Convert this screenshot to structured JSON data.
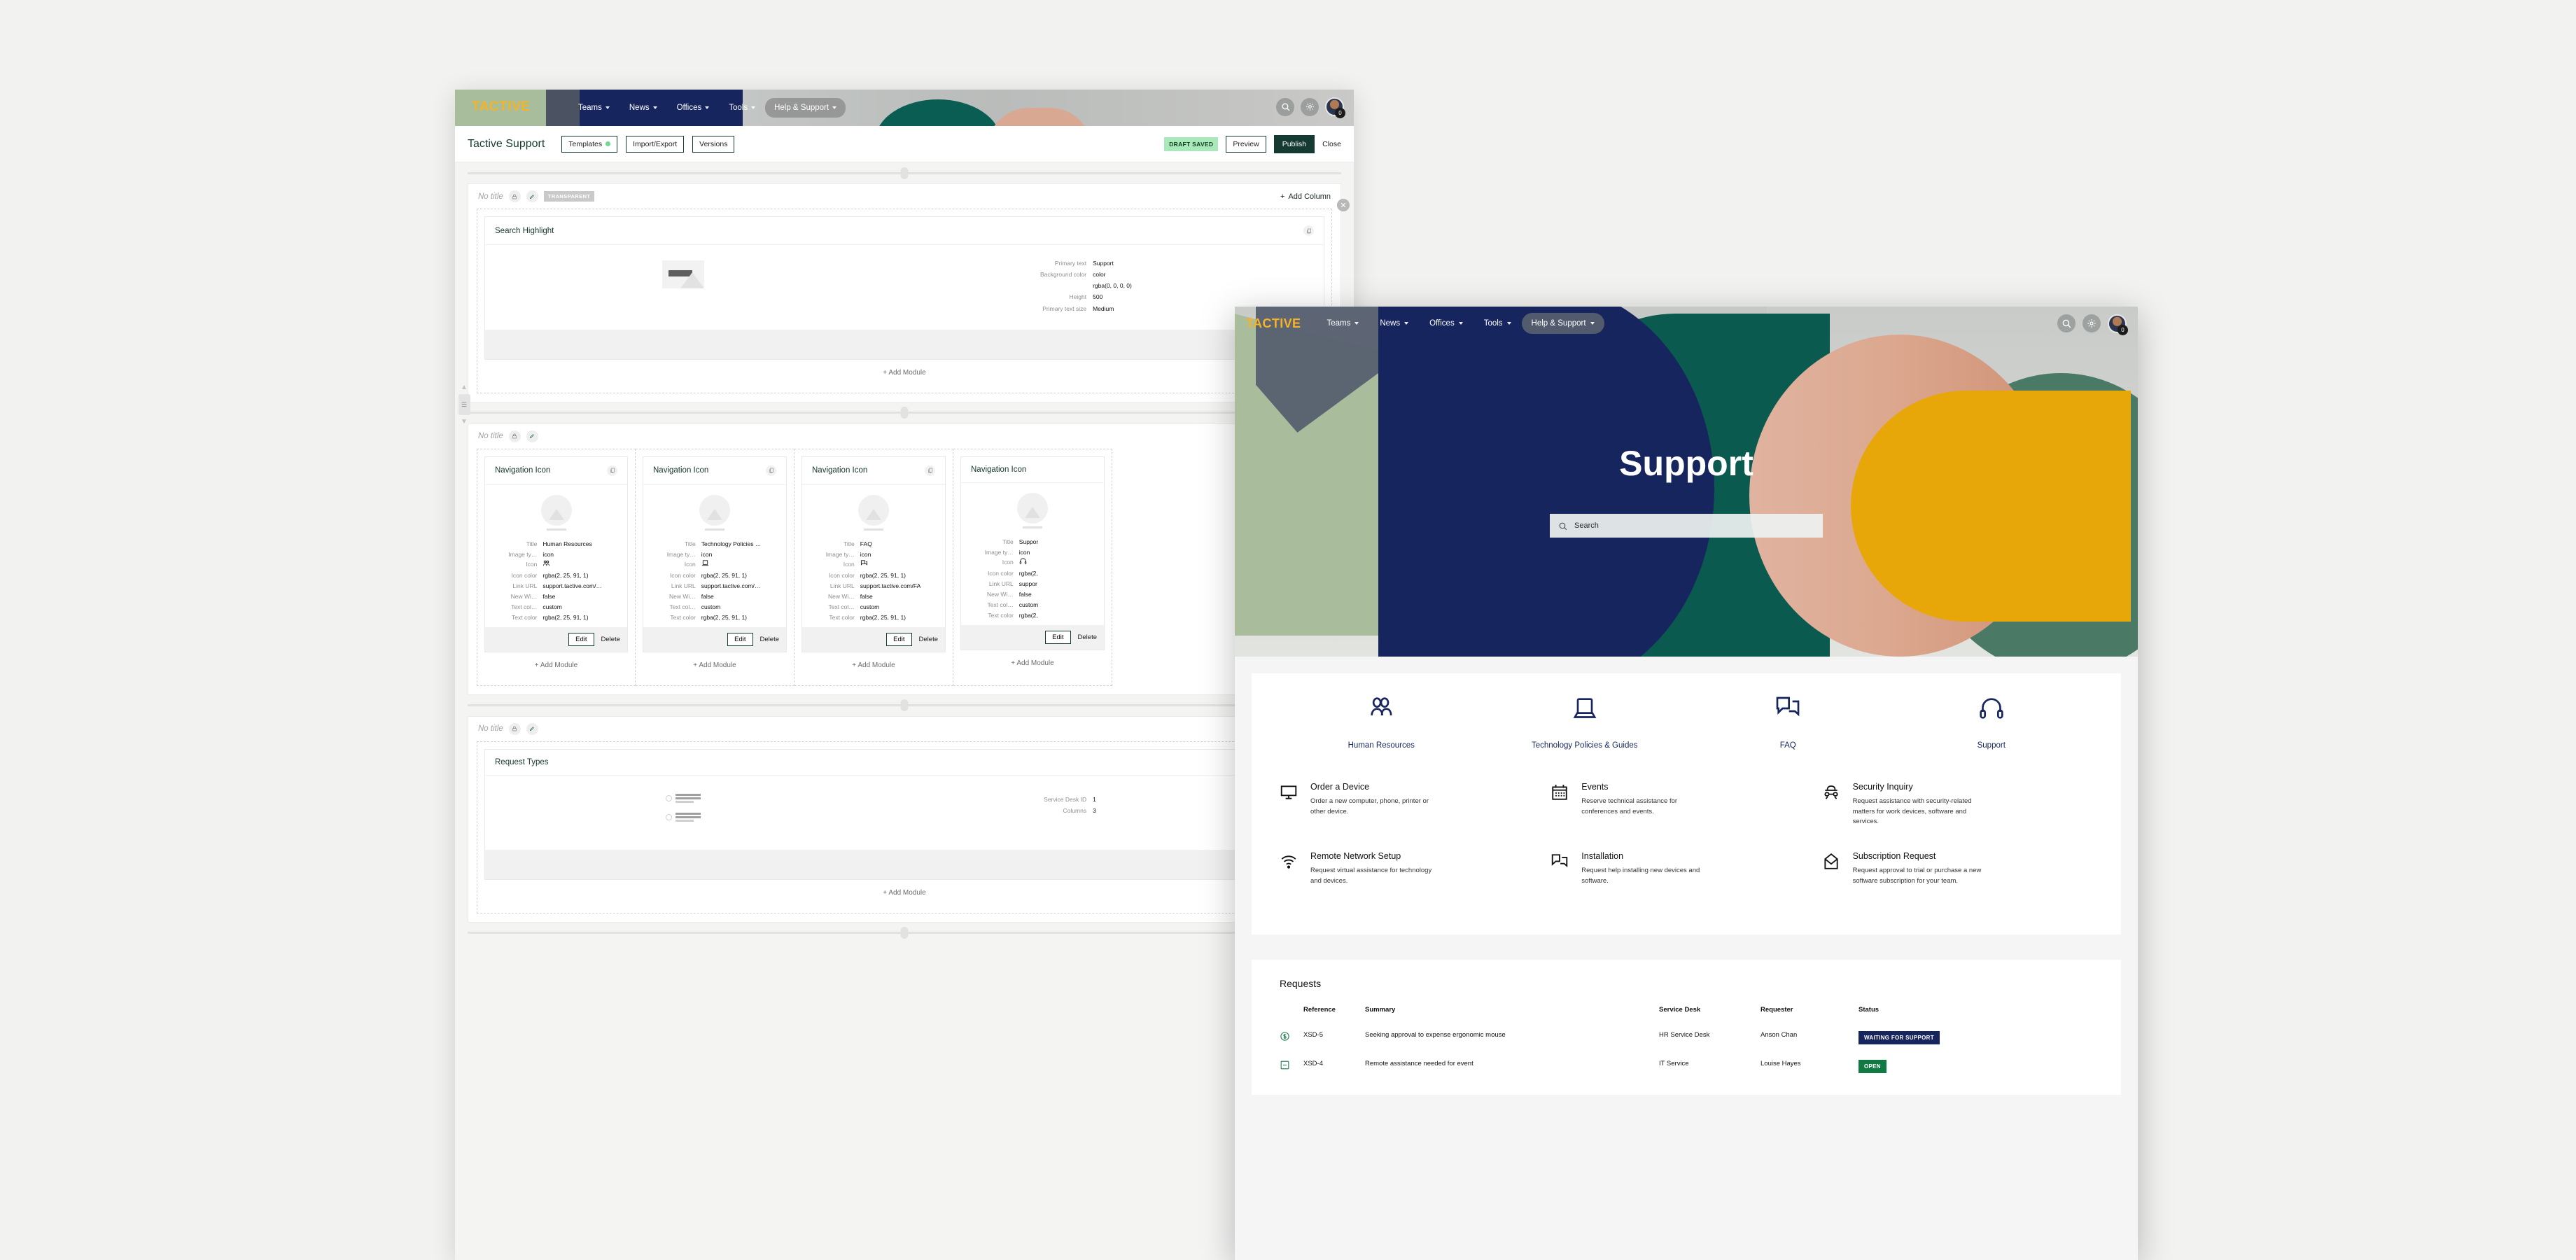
{
  "editor": {
    "brand": "TACTIVE",
    "nav": [
      {
        "label": "Teams",
        "caret": true,
        "pill": false
      },
      {
        "label": "News",
        "caret": true,
        "pill": false
      },
      {
        "label": "Offices",
        "caret": true,
        "pill": false
      },
      {
        "label": "Tools",
        "caret": true,
        "pill": false
      },
      {
        "label": "Help & Support",
        "caret": true,
        "pill": true
      }
    ],
    "avatar_badge": "0",
    "toolbar": {
      "title": "Tactive Support",
      "templates_label": "Templates",
      "import_export_label": "Import/Export",
      "versions_label": "Versions",
      "draft_status": "DRAFT SAVED",
      "preview_label": "Preview",
      "publish_label": "Publish",
      "close_label": "Close"
    },
    "sections": [
      {
        "title_placeholder": "No title",
        "tag": "TRANSPARENT",
        "add_column_label": "Add Column",
        "add_module_label": "Add Module"
      },
      {
        "title_placeholder": "No title",
        "add_module_label": "Add Module"
      },
      {
        "title_placeholder": "No title",
        "add_module_label": "Add Module"
      }
    ],
    "search_highlight_module": {
      "title": "Search Highlight",
      "fields": [
        {
          "key": "Primary text",
          "value": "Support"
        },
        {
          "key": "Background color",
          "value": "color"
        },
        {
          "key": "",
          "value": "rgba(0, 0, 0, 0)"
        },
        {
          "key": "Height",
          "value": "500"
        },
        {
          "key": "Primary text size",
          "value": "Medium"
        }
      ]
    },
    "nav_icon_modules": [
      {
        "title": "Navigation Icon",
        "icon_glyph": "people",
        "fields": [
          {
            "key": "Title",
            "value": "Human Resources"
          },
          {
            "key": "Image ty…",
            "value": "icon"
          },
          {
            "key": "Icon",
            "value": "",
            "glyph": "people"
          },
          {
            "key": "Icon color",
            "value": "rgba(2, 25, 91, 1)"
          },
          {
            "key": "Link URL",
            "value": "support.tactive.com/…"
          },
          {
            "key": "New Wi…",
            "value": "false"
          },
          {
            "key": "Text col…",
            "value": "custom"
          },
          {
            "key": "Text color",
            "value": "rgba(2, 25, 91, 1)"
          }
        ],
        "edit_label": "Edit",
        "delete_label": "Delete"
      },
      {
        "title": "Navigation Icon",
        "icon_glyph": "laptop",
        "fields": [
          {
            "key": "Title",
            "value": "Technology Policies …"
          },
          {
            "key": "Image ty…",
            "value": "icon"
          },
          {
            "key": "Icon",
            "value": "",
            "glyph": "laptop"
          },
          {
            "key": "Icon color",
            "value": "rgba(2, 25, 91, 1)"
          },
          {
            "key": "Link URL",
            "value": "support.tactive.com/…"
          },
          {
            "key": "New Wi…",
            "value": "false"
          },
          {
            "key": "Text col…",
            "value": "custom"
          },
          {
            "key": "Text color",
            "value": "rgba(2, 25, 91, 1)"
          }
        ],
        "edit_label": "Edit",
        "delete_label": "Delete"
      },
      {
        "title": "Navigation Icon",
        "icon_glyph": "chat",
        "fields": [
          {
            "key": "Title",
            "value": "FAQ"
          },
          {
            "key": "Image ty…",
            "value": "icon"
          },
          {
            "key": "Icon",
            "value": "",
            "glyph": "chat"
          },
          {
            "key": "Icon color",
            "value": "rgba(2, 25, 91, 1)"
          },
          {
            "key": "Link URL",
            "value": "support.tactive.com/FA"
          },
          {
            "key": "New Wi…",
            "value": "false"
          },
          {
            "key": "Text col…",
            "value": "custom"
          },
          {
            "key": "Text color",
            "value": "rgba(2, 25, 91, 1)"
          }
        ],
        "edit_label": "Edit",
        "delete_label": "Delete"
      },
      {
        "title": "Navigation Icon",
        "icon_glyph": "headset",
        "fields": [
          {
            "key": "Title",
            "value": "Suppor"
          },
          {
            "key": "Image ty…",
            "value": "icon"
          },
          {
            "key": "Icon",
            "value": "",
            "glyph": "headset"
          },
          {
            "key": "Icon color",
            "value": "rgba(2,"
          },
          {
            "key": "Link URL",
            "value": "suppor"
          },
          {
            "key": "New Wi…",
            "value": "false"
          },
          {
            "key": "Text col…",
            "value": "custom"
          },
          {
            "key": "Text color",
            "value": "rgba(2,"
          }
        ],
        "edit_label": "Edit",
        "delete_label": "Delete"
      }
    ],
    "request_types_module": {
      "title": "Request Types",
      "fields": [
        {
          "key": "Service Desk ID",
          "value": "1"
        },
        {
          "key": "Columns",
          "value": "3"
        }
      ],
      "add_module_label": "Add Module"
    }
  },
  "preview": {
    "brand": "TACTIVE",
    "nav": [
      {
        "label": "Teams",
        "pill": false
      },
      {
        "label": "News",
        "pill": false
      },
      {
        "label": "Offices",
        "pill": false
      },
      {
        "label": "Tools",
        "pill": false
      },
      {
        "label": "Help & Support",
        "pill": true
      }
    ],
    "avatar_badge": "0",
    "hero_title": "Support",
    "search_placeholder": "Search",
    "nav_icons": [
      {
        "label": "Human Resources",
        "glyph": "people"
      },
      {
        "label": "Technology Policies & Guides",
        "glyph": "laptop"
      },
      {
        "label": "FAQ",
        "glyph": "chat"
      },
      {
        "label": "Support",
        "glyph": "headset"
      }
    ],
    "request_types": [
      {
        "glyph": "monitor",
        "title": "Order a Device",
        "desc": "Order a new computer, phone, printer or other device."
      },
      {
        "glyph": "calendar",
        "title": "Events",
        "desc": "Reserve technical assistance for conferences and events."
      },
      {
        "glyph": "detective",
        "title": "Security Inquiry",
        "desc": "Request assistance with security-related matters for work devices, software and services."
      },
      {
        "glyph": "wifi",
        "title": "Remote Network Setup",
        "desc": "Request virtual assistance for technology and devices."
      },
      {
        "glyph": "chat",
        "title": "Installation",
        "desc": "Request help installing new devices and software."
      },
      {
        "glyph": "envelope",
        "title": "Subscription Request",
        "desc": "Request approval to trial or purchase a new software subscription for your team."
      }
    ],
    "requests": {
      "title": "Requests",
      "columns": [
        "",
        "Reference",
        "Summary",
        "Service Desk",
        "Requester",
        "Status"
      ],
      "rows": [
        {
          "glyph": "dollar",
          "reference": "XSD-5",
          "summary": "Seeking approval to expense ergonomic mouse",
          "service_desk": "HR Service Desk",
          "requester": "Anson Chan",
          "status": "WAITING FOR SUPPORT",
          "status_color": "#17255e"
        },
        {
          "glyph": "note",
          "reference": "XSD-4",
          "summary": "Remote assistance needed for event",
          "service_desk": "IT Service",
          "requester": "Louise Hayes",
          "status": "OPEN",
          "status_color": "#117a43"
        }
      ]
    }
  },
  "colors": {
    "brand_yellow": "#f5b325",
    "navy": "#17255e",
    "dark_green": "#153a32",
    "teal": "#0b5a50",
    "hero_yellow": "#e8a709",
    "pink": "#dca88f",
    "sage": "#a9bd9c"
  }
}
